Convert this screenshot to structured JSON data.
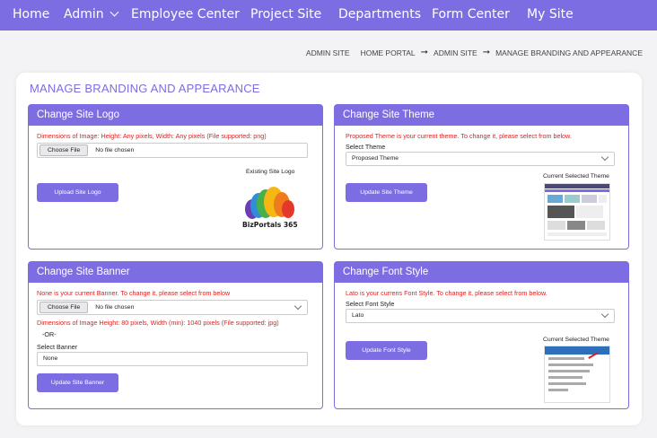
{
  "nav": {
    "items": [
      "Home",
      "Admin",
      "Employee Center",
      "Project Site",
      "Departments",
      "Form Center",
      "My Site"
    ]
  },
  "breadcrumb": {
    "first": "ADMIN SITE",
    "items": [
      "HOME PORTAL",
      "ADMIN SITE",
      "MANAGE BRANDING AND APPEARANCE"
    ]
  },
  "page": {
    "title": "MANAGE BRANDING AND APPEARANCE"
  },
  "logo_card": {
    "title": "Change Site Logo",
    "dimensions_note": "Dimensions of Image: Height: Any pixels, Width: Any pixels (File supported: png)",
    "choose_file": "Choose File",
    "no_file": "No file chosen",
    "existing_label": "Existing Site Logo",
    "logo_text": "BizPortals 365",
    "button": "Upload Site Logo"
  },
  "theme_card": {
    "title": "Change Site Theme",
    "note": "Proposed Theme is your current theme. To change it, please select from below.",
    "select_label": "Select Theme",
    "selected": "Proposed Theme",
    "current_label": "Current Selected Theme",
    "button": "Update Site Theme"
  },
  "banner_card": {
    "title": "Change Site Banner",
    "note": "None is your current Banner. To change it, please select from below",
    "choose_file": "Choose File",
    "no_file": "No file chosen",
    "dimensions_note": "Dimensions of Image Height: 80 pixels, Width (min): 1040 pixels (File supported: jpg)",
    "or": "-OR-",
    "select_label": "Select Banner",
    "selected": "None",
    "button": "Update Site Banner"
  },
  "font_card": {
    "title": "Change Font Style",
    "note": "Lato is your currens Font Style. To change it, please select from below.",
    "select_label": "Select Font Style",
    "selected": "Lato",
    "current_label": "Current Selected Theme",
    "button": "Update Font Style"
  },
  "colors": {
    "accent": "#7d6de3",
    "warning": "#e02020"
  }
}
